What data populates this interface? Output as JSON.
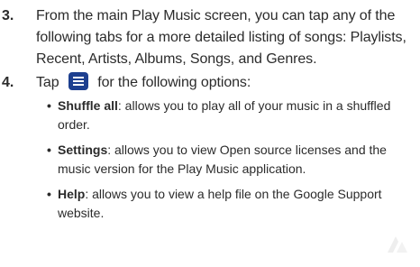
{
  "steps": [
    {
      "number": "3.",
      "text": "From the main Play Music screen, you can tap any of the following tabs for a more detailed listing of songs: Playlists, Recent, Artists, Albums, Songs, and Genres."
    },
    {
      "number": "4.",
      "text_before_icon": "Tap",
      "icon": "menu-icon",
      "text_after_icon": "for the following options:",
      "bullets": [
        {
          "term": "Shuffle all",
          "desc": ": allows you to play all of your music in a shuffled order."
        },
        {
          "term": "Settings",
          "desc": ": allows you to view Open source licenses and the music version for the Play Music application."
        },
        {
          "term": "Help",
          "desc": ": allows you to view a help file on the Google Support website."
        }
      ]
    }
  ],
  "colors": {
    "icon_bg": "#1d3f8f",
    "text": "#2b2b2b"
  }
}
